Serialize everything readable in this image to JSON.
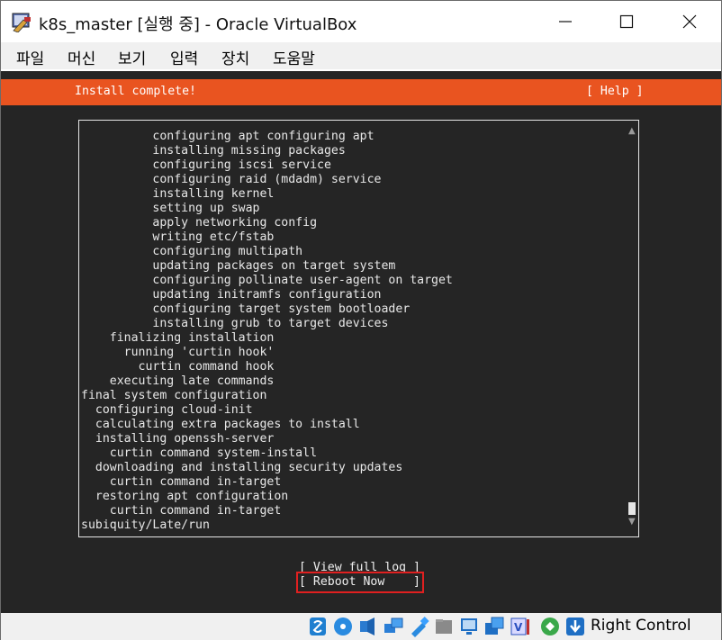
{
  "window": {
    "title": "k8s_master [실행 중] - Oracle VirtualBox"
  },
  "menu": [
    "파일",
    "머신",
    "보기",
    "입력",
    "장치",
    "도움말"
  ],
  "installer": {
    "header_title": "Install complete!",
    "help_label": "[ Help ]",
    "log_lines": [
      "          configuring apt configuring apt",
      "          installing missing packages",
      "          configuring iscsi service",
      "          configuring raid (mdadm) service",
      "          installing kernel",
      "          setting up swap",
      "          apply networking config",
      "          writing etc/fstab",
      "          configuring multipath",
      "          updating packages on target system",
      "          configuring pollinate user-agent on target",
      "          updating initramfs configuration",
      "          configuring target system bootloader",
      "          installing grub to target devices",
      "    finalizing installation",
      "      running 'curtin hook'",
      "        curtin command hook",
      "    executing late commands",
      "final system configuration",
      "  configuring cloud-init",
      "  calculating extra packages to install",
      "  installing openssh-server",
      "    curtin command system-install",
      "  downloading and installing security updates",
      "    curtin command in-target",
      "  restoring apt configuration",
      "    curtin command in-target",
      "subiquity/Late/run"
    ],
    "scroll_up": "▲",
    "scroll_down": "▼",
    "view_full_log": "[ View full log ]",
    "reboot_now": "[ Reboot Now    ]"
  },
  "statusbar": {
    "host_key": "Right Control",
    "icons": [
      "optical-drive-icon",
      "cd-icon",
      "audio-icon",
      "network-icon",
      "usb-icon",
      "shared-folder-icon",
      "display-icon",
      "screen-capture-icon",
      "virtualization-icon",
      "mouse-integration-icon",
      "download-icon"
    ]
  },
  "colors": {
    "accent": "#e95420",
    "terminal_bg": "#252525",
    "highlight": "#e02020"
  }
}
